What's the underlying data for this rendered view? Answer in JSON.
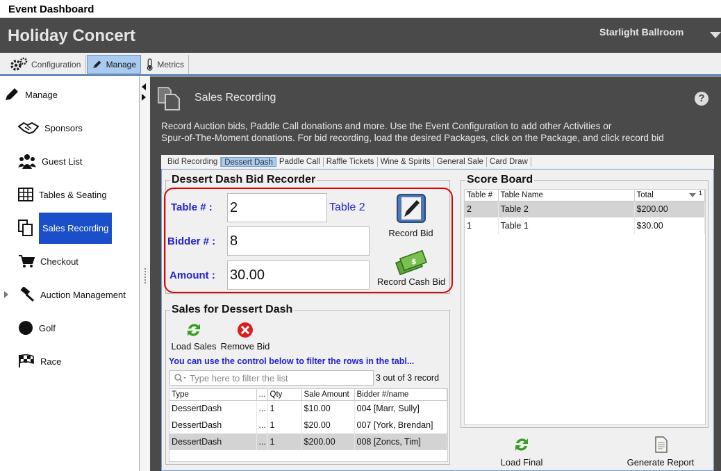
{
  "window": {
    "title": "Event Dashboard"
  },
  "header": {
    "event_title": "Holiday Concert",
    "venue": "Starlight Ballroom"
  },
  "nav_tabs": [
    {
      "label": "Configuration",
      "icon": "gears-icon"
    },
    {
      "label": "Manage",
      "icon": "pencil-icon",
      "active": true
    },
    {
      "label": "Metrics",
      "icon": "thermometer-icon"
    }
  ],
  "sidebar": {
    "items": [
      {
        "label": "Manage",
        "icon": "pencil-icon"
      },
      {
        "label": "Sponsors",
        "icon": "handshake-icon"
      },
      {
        "label": "Guest List",
        "icon": "people-icon"
      },
      {
        "label": "Tables & Seating",
        "icon": "table-grid-icon"
      },
      {
        "label": "Sales Recording",
        "icon": "documents-icon",
        "active": true
      },
      {
        "label": "Checkout",
        "icon": "cart-icon"
      },
      {
        "label": "Auction Management",
        "icon": "gavel-icon"
      },
      {
        "label": "Golf",
        "icon": "circle-icon"
      },
      {
        "label": "Race",
        "icon": "checkered-flag-icon"
      }
    ]
  },
  "main": {
    "title": "Sales Recording",
    "help": "?",
    "description_line1": "Record Auction bids, Paddle Call donations and more. Use the Event Configuration to add other Activities or",
    "description_line2": "Spur-of-The-Moment donations. For bid recording, load the desired Packages, click on the Package, and click record bid",
    "sub_tabs": [
      "Bid Recording",
      "Dessert Dash",
      "Paddle Call",
      "Raffle Tickets",
      "Wine & Spirits",
      "General Sale",
      "Card Draw"
    ],
    "active_sub_tab": "Dessert Dash"
  },
  "recorder": {
    "title": "Dessert Dash Bid Recorder",
    "table_label": "Table # :",
    "table_value": "2",
    "table_name": "Table 2",
    "bidder_label": "Bidder # :",
    "bidder_value": "8",
    "amount_label": "Amount :",
    "amount_value": "30.00",
    "record_bid": "Record Bid",
    "record_cash_bid": "Record Cash Bid"
  },
  "sales": {
    "title": "Sales for Dessert Dash",
    "load_sales": "Load Sales",
    "remove_bid": "Remove Bid",
    "hint": "You can use the control below to filter the rows in the tabl...",
    "filter_placeholder": "Type here to filter the list",
    "record_count": "3 out of 3 record",
    "columns": [
      "Type",
      "...",
      "Qty",
      "Sale Amount",
      "Bidder #/name"
    ],
    "rows": [
      [
        "DessertDash",
        "...",
        "1",
        "$10.00",
        "004 [Marr, Sully]"
      ],
      [
        "DessertDash",
        "...",
        "1",
        "$20.00",
        "007 [York, Brendan]"
      ],
      [
        "DessertDash",
        "...",
        "1",
        "$200.00",
        "008 [Zoncs, Tim]"
      ]
    ],
    "selected_row": 2
  },
  "scoreboard": {
    "title": "Score Board",
    "columns": [
      "Table #",
      "Table Name",
      "Total"
    ],
    "sort_indicator": "1",
    "rows": [
      [
        "2",
        "Table 2",
        "$200.00"
      ],
      [
        "1",
        "Table 1",
        "$30.00"
      ]
    ],
    "selected_row": 0,
    "load_final": "Load Final",
    "generate_report": "Generate Report"
  },
  "colors": {
    "header_bg": "#4a4a4a",
    "accent_blue": "#1a4fc9",
    "label_blue": "#2222cc",
    "highlight_red": "#e00000",
    "tab_active": "#a9cbef"
  }
}
